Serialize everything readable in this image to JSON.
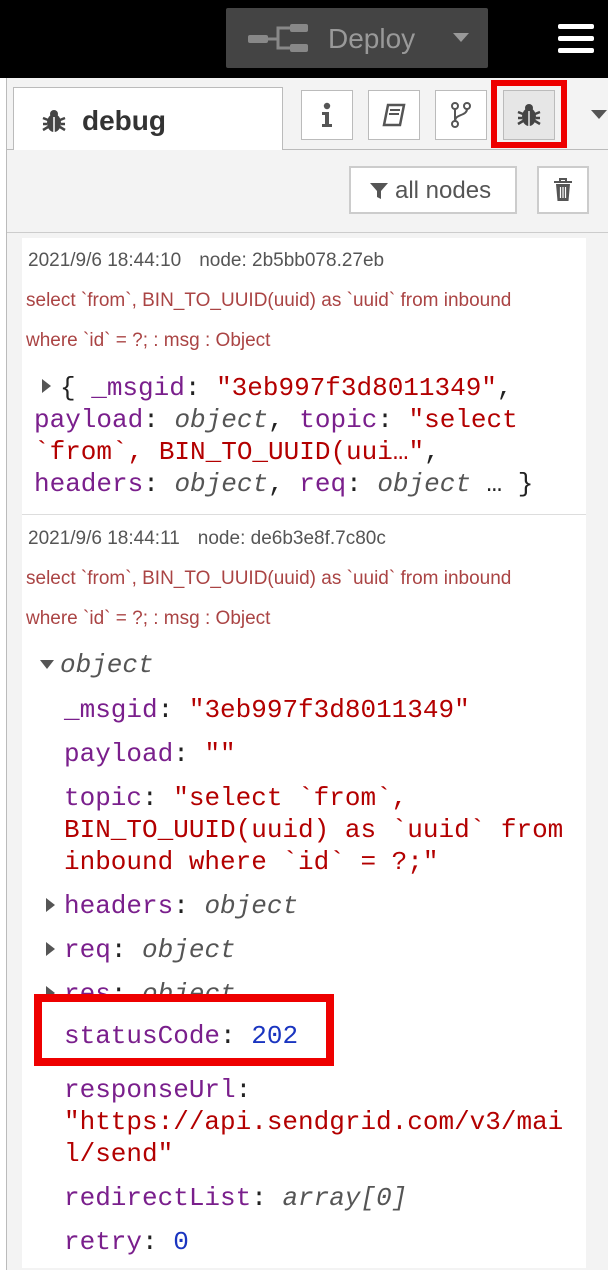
{
  "header": {
    "deploy_label": "Deploy"
  },
  "sidebar": {
    "active_tab_label": "debug",
    "tab_icons": [
      "info-icon",
      "book-icon",
      "branch-icon",
      "bug-icon"
    ],
    "filter_label": "all nodes"
  },
  "messages": [
    {
      "timestamp": "2021/9/6 18:44:10",
      "node": "node: 2b5bb078.27eb",
      "topic_line1": "select `from`, BIN_TO_UUID(uuid) as `uuid` from inbound",
      "topic_line2": "where `id` = ?; : msg : Object",
      "summary": {
        "open": "{ ",
        "k1": "_msgid",
        "v1": "\"3eb997f3d8011349\"",
        "k2": "payload",
        "v2": "object",
        "k3": "topic",
        "v3a": "\"select",
        "v3b": "`from`, BIN_TO_UUID(uui…\"",
        "k4": "headers",
        "v4": "object",
        "k5": "req",
        "v5": "object",
        "close": " … }"
      }
    },
    {
      "timestamp": "2021/9/6 18:44:11",
      "node": "node: de6b3e8f.7c80c",
      "topic_line1": "select `from`, BIN_TO_UUID(uuid) as `uuid` from inbound",
      "topic_line2": "where `id` = ?; : msg : Object",
      "root_label": "object",
      "fields": {
        "msgid_key": "_msgid",
        "msgid_val": "\"3eb997f3d8011349\"",
        "payload_key": "payload",
        "payload_val": "\"\"",
        "topic_key": "topic",
        "topic_val1": "\"select `from`,",
        "topic_val2": "BIN_TO_UUID(uuid) as `uuid` from",
        "topic_val3": "inbound where `id` = ?;\"",
        "headers_key": "headers",
        "headers_val": "object",
        "req_key": "req",
        "req_val": "object",
        "res_key": "res",
        "res_val": "object",
        "status_key": "statusCode",
        "status_val": "202",
        "resurl_key": "responseUrl",
        "resurl_val1": "\"https://api.sendgrid.com/v3/mai",
        "resurl_val2": "l/send\"",
        "redirect_key": "redirectList",
        "redirect_val": "array[0]",
        "retry_key": "retry",
        "retry_val": "0"
      }
    }
  ],
  "colors": {
    "highlight": "#ee0000",
    "key": "#7a1f8c",
    "string": "#b30000",
    "number": "#1a35c0",
    "topic_text": "#aa4444"
  }
}
